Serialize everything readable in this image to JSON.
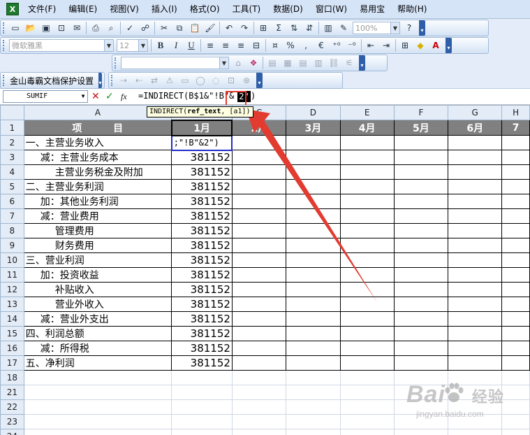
{
  "menu": [
    "文件(F)",
    "编辑(E)",
    "视图(V)",
    "插入(I)",
    "格式(O)",
    "工具(T)",
    "数据(D)",
    "窗口(W)",
    "易用宝",
    "帮助(H)"
  ],
  "toolbar": {
    "zoom_value": "100%",
    "font_name": "微软雅黑",
    "font_size": "12",
    "bold": "B",
    "italic": "I",
    "underline": "U",
    "percent": "%",
    "euro": "€",
    "security_label": "金山毒霸文档保护设置",
    "sigma": "Σ"
  },
  "formula_bar": {
    "name_box": "SUMIF",
    "fx": "fx",
    "formula_prefix": "=INDIRECT(B$1&\"!B\"&",
    "formula_selected": "2\"",
    "formula_suffix": ")",
    "tooltip_fn": "INDIRECT(",
    "tooltip_arg1": "ref_text",
    "tooltip_rest": ", [a1])"
  },
  "columns": [
    "A",
    "B",
    "C",
    "D",
    "E",
    "F",
    "G",
    "H"
  ],
  "header_row": {
    "item": "项  目",
    "months": [
      "1月",
      "2月",
      "3月",
      "4月",
      "5月",
      "6月",
      "7"
    ]
  },
  "rows": [
    {
      "num": "2",
      "item": "一、主营业务收入",
      "value": ";\"!B\"&2\")",
      "indent": 0
    },
    {
      "num": "3",
      "item": "减：主营业务成本",
      "value": "381152",
      "indent": 1
    },
    {
      "num": "4",
      "item": "主营业务税金及附加",
      "value": "381152",
      "indent": 2
    },
    {
      "num": "5",
      "item": "二、主营业务利润",
      "value": "381152",
      "indent": 0
    },
    {
      "num": "6",
      "item": "加：其他业务利润",
      "value": "381152",
      "indent": 1
    },
    {
      "num": "7",
      "item": "减：营业费用",
      "value": "381152",
      "indent": 1
    },
    {
      "num": "8",
      "item": "管理费用",
      "value": "381152",
      "indent": 2
    },
    {
      "num": "9",
      "item": "财务费用",
      "value": "381152",
      "indent": 2
    },
    {
      "num": "10",
      "item": "三、营业利润",
      "value": "381152",
      "indent": 0
    },
    {
      "num": "11",
      "item": "加：投资收益",
      "value": "381152",
      "indent": 1
    },
    {
      "num": "12",
      "item": "补贴收入",
      "value": "381152",
      "indent": 2
    },
    {
      "num": "13",
      "item": "营业外收入",
      "value": "381152",
      "indent": 2
    },
    {
      "num": "14",
      "item": "减：营业外支出",
      "value": "381152",
      "indent": 1
    },
    {
      "num": "15",
      "item": "四、利润总额",
      "value": "381152",
      "indent": 0
    },
    {
      "num": "16",
      "item": "减：所得税",
      "value": "381152",
      "indent": 1
    },
    {
      "num": "17",
      "item": "五、净利润",
      "value": "381152",
      "indent": 0
    }
  ],
  "empty_rows": [
    "18",
    "21",
    "22",
    "23",
    "24"
  ],
  "watermark": {
    "brand": "Bai",
    "brand2": "经验",
    "url": "jingyan.baidu.com"
  },
  "colors": {
    "accent_red": "#e23b30",
    "selection_blue": "#1f2cc5",
    "header_gray": "#808080"
  }
}
